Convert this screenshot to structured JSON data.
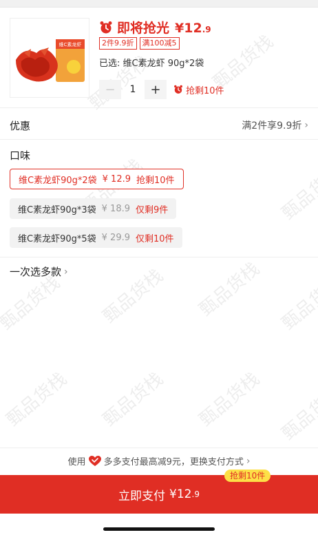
{
  "product": {
    "flash_text": "即将抢光",
    "price_symbol": "¥",
    "price_int": "12",
    "price_dec": ".9",
    "tags": [
      "2件9.9折",
      "满100减5"
    ],
    "selected_text": "已选: 维C素龙虾 90g*2袋",
    "quantity": "1",
    "minus_label": "−",
    "plus_label": "+",
    "stock_hint": "抢剩10件",
    "package_label": "维C素龙虾"
  },
  "promo": {
    "label": "优惠",
    "value": "满2件享9.9折"
  },
  "flavor": {
    "title": "口味",
    "options": [
      {
        "name": "维C素龙虾90g*2袋",
        "price": "¥ 12.9",
        "stock": "抢剩10件",
        "selected": true
      },
      {
        "name": "维C素龙虾90g*3袋",
        "price": "¥ 18.9",
        "stock": "仅剩9件",
        "selected": false
      },
      {
        "name": "维C素龙虾90g*5袋",
        "price": "¥ 29.9",
        "stock": "仅剩10件",
        "selected": false
      }
    ]
  },
  "multi_select": "一次选多款",
  "pay_hint": {
    "prefix": "使用",
    "suffix": "多多支付最高减9元，更换支付方式"
  },
  "pay_button": {
    "label": "立即支付",
    "price_int": "¥12",
    "price_dec": ".9",
    "badge": "抢剩10件"
  },
  "watermark": "甄品货栈",
  "colors": {
    "accent": "#e02e24",
    "badge_bg": "#fde047"
  }
}
